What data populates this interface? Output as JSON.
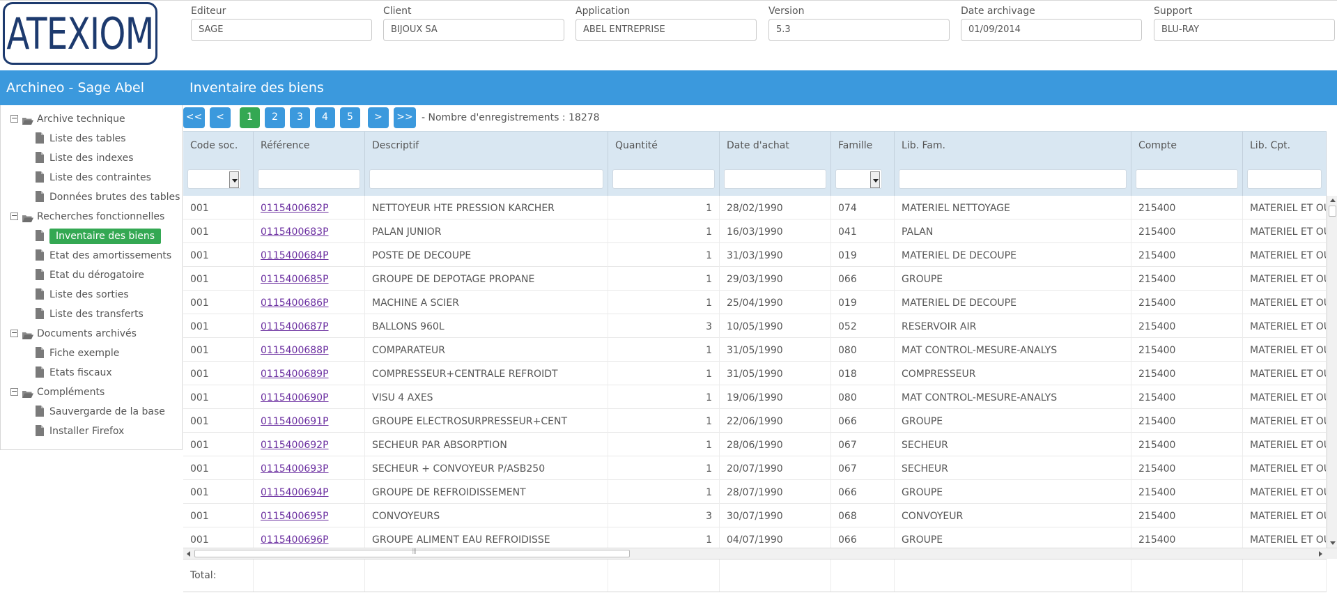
{
  "logo": {
    "text": "ATEXIOM"
  },
  "header_fields": [
    {
      "label": "Editeur",
      "value": "SAGE"
    },
    {
      "label": "Client",
      "value": "BIJOUX SA"
    },
    {
      "label": "Application",
      "value": "ABEL ENTREPRISE"
    },
    {
      "label": "Version",
      "value": "5.3"
    },
    {
      "label": "Date archivage",
      "value": "01/09/2014"
    },
    {
      "label": "Support",
      "value": "BLU-RAY"
    }
  ],
  "titlebar": {
    "app_title": "Archineo - Sage Abel",
    "page_title": "Inventaire des biens",
    "color": "#3b99dd"
  },
  "sidebar": {
    "groups": [
      {
        "label": "Archive technique",
        "toggle": "⊟",
        "items": [
          "Liste des tables",
          "Liste des indexes",
          "Liste des contraintes",
          "Données brutes des tables"
        ]
      },
      {
        "label": "Recherches fonctionnelles",
        "toggle": "⊟",
        "items": [
          "Inventaire des biens",
          "Etat des amortissements",
          "Etat du dérogatoire",
          "Liste des sorties",
          "Liste des transferts"
        ]
      },
      {
        "label": "Documents archivés",
        "toggle": "⊟",
        "items": [
          "Fiche exemple",
          "Etats fiscaux"
        ]
      },
      {
        "label": "Compléments",
        "toggle": "⊟",
        "items": [
          "Sauvergarde de la base",
          "Installer Firefox"
        ]
      }
    ],
    "active_item": "Inventaire des biens",
    "active_color": "#34a853"
  },
  "pager": {
    "first": "<<",
    "prev": "<",
    "pages": [
      "1",
      "2",
      "3",
      "4",
      "5"
    ],
    "current": "1",
    "next": ">",
    "last": ">>",
    "record_count_text": "- Nombre d'enregistrements : 18278"
  },
  "grid": {
    "columns": [
      "Code soc.",
      "Référence",
      "Descriptif",
      "Quantité",
      "Date d'achat",
      "Famille",
      "Lib. Fam.",
      "Compte",
      "Lib. Cpt."
    ],
    "filter_dropdown_columns": [
      "Code soc.",
      "Famille"
    ],
    "rows": [
      [
        "001",
        "0115400682P",
        "NETTOYEUR HTE PRESSION KARCHER",
        "1",
        "28/02/1990",
        "074",
        "MATERIEL NETTOYAGE",
        "215400",
        "MATERIEL ET OU"
      ],
      [
        "001",
        "0115400683P",
        "PALAN JUNIOR",
        "1",
        "16/03/1990",
        "041",
        "PALAN",
        "215400",
        "MATERIEL ET OU"
      ],
      [
        "001",
        "0115400684P",
        "POSTE DE DECOUPE",
        "1",
        "31/03/1990",
        "019",
        "MATERIEL DE DECOUPE",
        "215400",
        "MATERIEL ET OU"
      ],
      [
        "001",
        "0115400685P",
        "GROUPE DE DEPOTAGE PROPANE",
        "1",
        "29/03/1990",
        "066",
        "GROUPE",
        "215400",
        "MATERIEL ET OU"
      ],
      [
        "001",
        "0115400686P",
        "MACHINE A SCIER",
        "1",
        "25/04/1990",
        "019",
        "MATERIEL DE DECOUPE",
        "215400",
        "MATERIEL ET OU"
      ],
      [
        "001",
        "0115400687P",
        "BALLONS 960L",
        "3",
        "10/05/1990",
        "052",
        "RESERVOIR AIR",
        "215400",
        "MATERIEL ET OU"
      ],
      [
        "001",
        "0115400688P",
        "COMPARATEUR",
        "1",
        "31/05/1990",
        "080",
        "MAT CONTROL-MESURE-ANALYS",
        "215400",
        "MATERIEL ET OU"
      ],
      [
        "001",
        "0115400689P",
        "COMPRESSEUR+CENTRALE REFROIDT",
        "1",
        "31/05/1990",
        "018",
        "COMPRESSEUR",
        "215400",
        "MATERIEL ET OU"
      ],
      [
        "001",
        "0115400690P",
        "VISU 4 AXES",
        "1",
        "19/06/1990",
        "080",
        "MAT CONTROL-MESURE-ANALYS",
        "215400",
        "MATERIEL ET OU"
      ],
      [
        "001",
        "0115400691P",
        "GROUPE ELECTROSURPRESSEUR+CENT",
        "1",
        "22/06/1990",
        "066",
        "GROUPE",
        "215400",
        "MATERIEL ET OU"
      ],
      [
        "001",
        "0115400692P",
        "SECHEUR PAR ABSORPTION",
        "1",
        "28/06/1990",
        "067",
        "SECHEUR",
        "215400",
        "MATERIEL ET OU"
      ],
      [
        "001",
        "0115400693P",
        "SECHEUR + CONVOYEUR P/ASB250",
        "1",
        "20/07/1990",
        "067",
        "SECHEUR",
        "215400",
        "MATERIEL ET OU"
      ],
      [
        "001",
        "0115400694P",
        "GROUPE DE REFROIDISSEMENT",
        "1",
        "28/07/1990",
        "066",
        "GROUPE",
        "215400",
        "MATERIEL ET OU"
      ],
      [
        "001",
        "0115400695P",
        "CONVOYEURS",
        "3",
        "30/07/1990",
        "068",
        "CONVOYEUR",
        "215400",
        "MATERIEL ET OU"
      ],
      [
        "001",
        "0115400696P",
        "GROUPE ALIMENT EAU REFROIDISSE",
        "1",
        "04/07/1990",
        "066",
        "GROUPE",
        "215400",
        "MATERIEL ET OU"
      ]
    ],
    "footer_label": "Total:",
    "link_color": "#6b2fa0"
  }
}
